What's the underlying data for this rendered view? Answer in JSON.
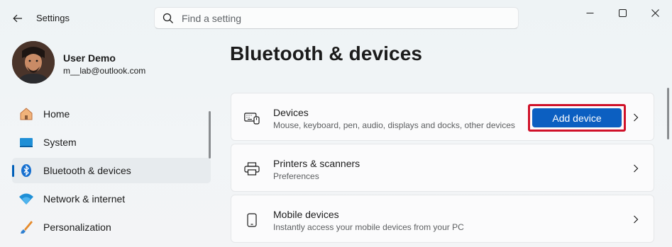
{
  "window": {
    "app_title": "Settings",
    "controls": [
      "minimize-icon",
      "maximize-icon",
      "close-icon"
    ]
  },
  "search": {
    "placeholder": "Find a setting",
    "value": ""
  },
  "user": {
    "name": "User Demo",
    "email": "m__lab@outlook.com"
  },
  "nav": {
    "items": [
      {
        "label": "Home",
        "icon": "home-icon",
        "active": false
      },
      {
        "label": "System",
        "icon": "system-icon",
        "active": false
      },
      {
        "label": "Bluetooth & devices",
        "icon": "bluetooth-icon",
        "active": true
      },
      {
        "label": "Network & internet",
        "icon": "wifi-icon",
        "active": false
      },
      {
        "label": "Personalization",
        "icon": "brush-icon",
        "active": false
      }
    ]
  },
  "page": {
    "title": "Bluetooth & devices"
  },
  "cards": [
    {
      "title": "Devices",
      "subtitle": "Mouse, keyboard, pen, audio, displays and docks, other devices",
      "icon": "devices-icon",
      "button": "Add device"
    },
    {
      "title": "Printers & scanners",
      "subtitle": "Preferences",
      "icon": "printer-icon"
    },
    {
      "title": "Mobile devices",
      "subtitle": "Instantly access your mobile devices from your PC",
      "icon": "phone-icon"
    }
  ],
  "colors": {
    "accent": "#0c5fc1",
    "highlight": "#d0122a",
    "nav_indicator": "#005fb8"
  }
}
